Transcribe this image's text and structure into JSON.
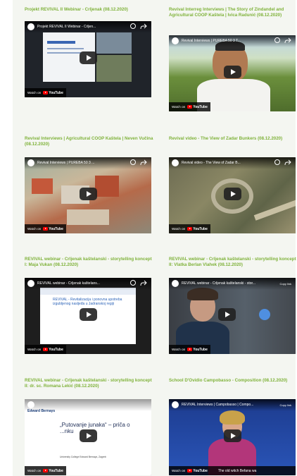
{
  "videos": [
    {
      "title": "Projekt REVIVAL II Webinar - Crljenak (08.12.2020)",
      "video_title": "Projekt REVIVAL II Webinar - Crljen...",
      "watch_label": "Watch on",
      "scene": "slides-presentation"
    },
    {
      "title": "Revival Interreg Interviews | The Story of Zindandel and Agricultural COOP Kaštela | Ivica Radunić (08.12.2020)",
      "video_title": "Revival Interviews | PUREBA 50 3 T...",
      "watch_label": "Watch on",
      "scene": "man-vineyard"
    },
    {
      "title": "Revival Interviews | Agricultural COOP Kaštela | Neven Vučina (08.12.2020)",
      "video_title": "Revival Interviews | PUREBA 50 3 ...",
      "watch_label": "Watch on",
      "scene": "aerial-town"
    },
    {
      "title": "Revival video - The View of Zadar Bunkers (08.12.2020)",
      "video_title": "Revival video - The View of Zadar B...",
      "watch_label": "Watch on",
      "scene": "aerial-bunkers"
    },
    {
      "title": "REVIVAL webinar - Crljenak kaštelanski - storytelling koncept I: Maja Vukan (08.12.2020)",
      "video_title": "REVIVAL webinar - Crljenak kaštelans...",
      "watch_label": "Watch on",
      "scene": "slide-revival",
      "slide_heading": "REVIVAL - Revitalizacija i ponovna upotreba izgubljenog nasljeđa u Jadranskoj regiji"
    },
    {
      "title": "REVIVAL webinar - Crljenak kaštelanski - storytelling koncept II: Vlatka Berlan Vlahek (08.12.2020)",
      "video_title": "REVIVAL webinar - Crljenak kaštelanski - stor...",
      "watch_label": "Watch on",
      "scene": "person-webcam",
      "overlay": "Copy link"
    },
    {
      "title": "REVIVAL webinar - Crljenak kaštelanski - storytelling koncept II: dr. sc. Romana Lekić (08.12.2020)",
      "video_title": "",
      "watch_label": "Watch on",
      "scene": "slide-putovanje",
      "slide_heading": "„Putovanje junaka“ – priča o ...nku",
      "slide_logo": "Edward Bernays",
      "slide_footer": "University College Edward Bernays, Zagreb"
    },
    {
      "title": "School D'Ovidio Campobasso - Composition (08.12.2020)",
      "video_title": "REVIVAL Interviews | Campobasso | Compo...",
      "watch_label": "Watch on",
      "scene": "speaker-blue",
      "overlay": "Copy link",
      "caption": "The old witch Befana wa"
    }
  ]
}
